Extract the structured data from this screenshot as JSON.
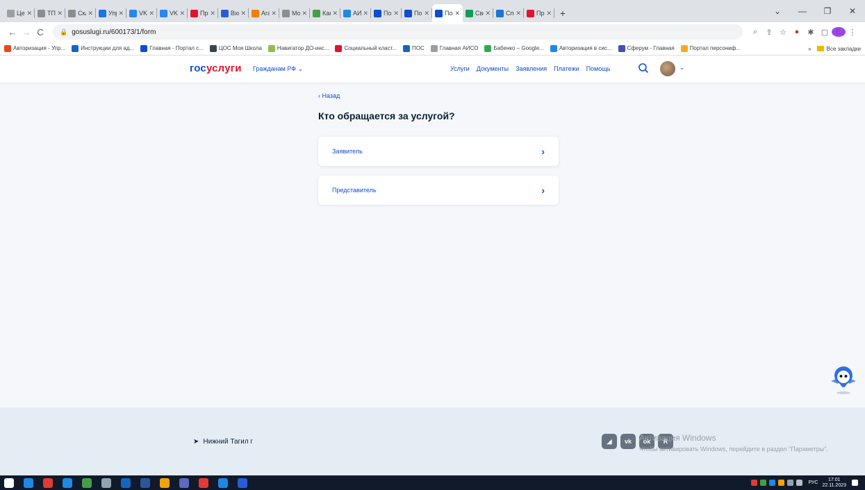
{
  "browser": {
    "tabs": [
      {
        "label": "Цен",
        "color": "#9e9e9e"
      },
      {
        "label": "ТП",
        "color": "#8d8d8d"
      },
      {
        "label": "Скл",
        "color": "#8d8d8d"
      },
      {
        "label": "Упр",
        "color": "#1a73e8"
      },
      {
        "label": "VK",
        "color": "#2787f5"
      },
      {
        "label": "VK",
        "color": "#2787f5"
      },
      {
        "label": "Про",
        "color": "#e3122f"
      },
      {
        "label": "Вхо",
        "color": "#2a5bd7"
      },
      {
        "label": "Ага",
        "color": "#f57c00"
      },
      {
        "label": "Мо",
        "color": "#8d8d8d"
      },
      {
        "label": "Как",
        "color": "#43a047"
      },
      {
        "label": "АИС",
        "color": "#1e88e5"
      },
      {
        "label": "Пор",
        "color": "#0d4cd3"
      },
      {
        "label": "Пор",
        "color": "#0d4cd3"
      },
      {
        "label": "Пор",
        "color": "#0d4cd3",
        "active": true
      },
      {
        "label": "Све",
        "color": "#0f9d58"
      },
      {
        "label": "Спе",
        "color": "#1976d2"
      },
      {
        "label": "Про",
        "color": "#e3122f"
      }
    ],
    "new_tab": "+",
    "window_controls": [
      "⌄",
      "—",
      "❐",
      "✕"
    ],
    "url": "gosuslugi.ru/600173/1/form",
    "bookmarks": [
      {
        "label": "Авторизация - Упр...",
        "color": "#e64a19"
      },
      {
        "label": "Инструкции для ад...",
        "color": "#1565c0"
      },
      {
        "label": "Главная - Портал с...",
        "color": "#0d4cd3"
      },
      {
        "label": "ЦОС Моя Школа",
        "color": "#37474f"
      },
      {
        "label": "Навигатор ДО-инс...",
        "color": "#8bc34a"
      },
      {
        "label": "Социальный класт...",
        "color": "#e3122f"
      },
      {
        "label": "ПОС",
        "color": "#1565c0"
      },
      {
        "label": "Главная АИСО",
        "color": "#9e9e9e"
      },
      {
        "label": "Бабенко – Google...",
        "color": "#34a853"
      },
      {
        "label": "Авторизация в сис...",
        "color": "#1e88e5"
      },
      {
        "label": "Сферум - Главная",
        "color": "#3f51b5"
      },
      {
        "label": "Портал персониф...",
        "color": "#f9a825"
      }
    ],
    "bookmarks_more": "»",
    "all_bookmarks": "Все закладки"
  },
  "site": {
    "logo_part1": "гос",
    "logo_part2": "услуги",
    "citizen_menu": "Гражданам РФ ⌄",
    "nav": [
      "Услуги",
      "Документы",
      "Заявления",
      "Платежи",
      "Помощь"
    ]
  },
  "form": {
    "back": "‹ Назад",
    "title": "Кто обращается за услугой?",
    "options": [
      {
        "label": "Заявитель"
      },
      {
        "label": "Представитель"
      }
    ]
  },
  "footer": {
    "location": "Нижний Тагил г",
    "socials": [
      "◢",
      "vk",
      "ok",
      "R"
    ],
    "activation_title": "Активация Windows",
    "activation_text": "Чтобы активировать Windows, перейдите в раздел \"Параметры\"."
  },
  "taskbar": {
    "apps": [
      "#ffffff",
      "#1e88e5",
      "#e53935",
      "#1e88e5",
      "#43a047",
      "#90a4ae",
      "#1565c0",
      "#2b579a",
      "#f0a30a",
      "#5c6bc0",
      "#e53935",
      "#1e88e5",
      "#2a5bd7"
    ],
    "lang": "РУС",
    "time": "17:01",
    "date": "22.11.2023"
  }
}
